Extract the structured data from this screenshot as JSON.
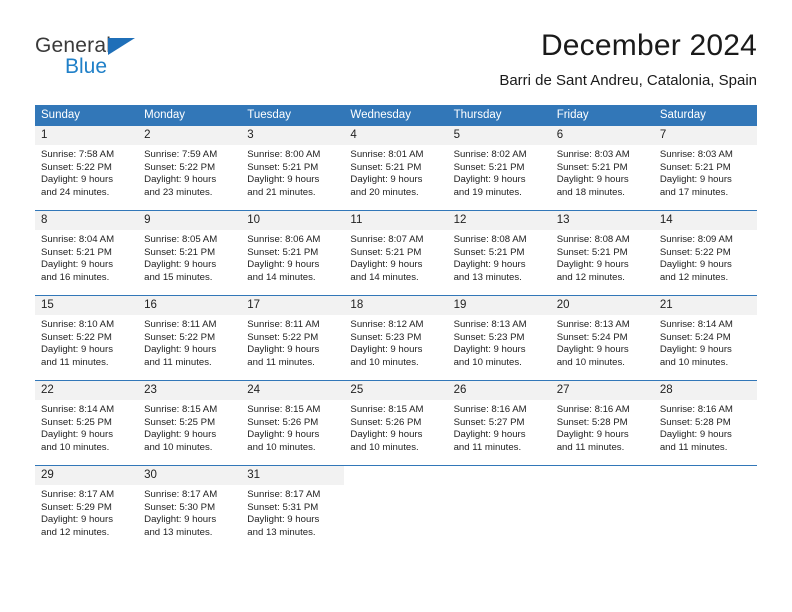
{
  "brand": {
    "name_part1": "General",
    "name_part2": "Blue",
    "accent_color": "#2080c8",
    "triangle_color": "#1f6fb8",
    "triangle_icon": "triangle-icon"
  },
  "header": {
    "title": "December 2024",
    "subtitle": "Barri de Sant Andreu, Catalonia, Spain"
  },
  "calendar": {
    "header_bg": "#3277b8",
    "header_text_color": "#ffffff",
    "daynum_bg": "#f2f2f2",
    "weekdays": [
      "Sunday",
      "Monday",
      "Tuesday",
      "Wednesday",
      "Thursday",
      "Friday",
      "Saturday"
    ],
    "weeks": [
      [
        {
          "day": "1",
          "sunrise": "Sunrise: 7:58 AM",
          "sunset": "Sunset: 5:22 PM",
          "daylight_line1": "Daylight: 9 hours",
          "daylight_line2": "and 24 minutes."
        },
        {
          "day": "2",
          "sunrise": "Sunrise: 7:59 AM",
          "sunset": "Sunset: 5:22 PM",
          "daylight_line1": "Daylight: 9 hours",
          "daylight_line2": "and 23 minutes."
        },
        {
          "day": "3",
          "sunrise": "Sunrise: 8:00 AM",
          "sunset": "Sunset: 5:21 PM",
          "daylight_line1": "Daylight: 9 hours",
          "daylight_line2": "and 21 minutes."
        },
        {
          "day": "4",
          "sunrise": "Sunrise: 8:01 AM",
          "sunset": "Sunset: 5:21 PM",
          "daylight_line1": "Daylight: 9 hours",
          "daylight_line2": "and 20 minutes."
        },
        {
          "day": "5",
          "sunrise": "Sunrise: 8:02 AM",
          "sunset": "Sunset: 5:21 PM",
          "daylight_line1": "Daylight: 9 hours",
          "daylight_line2": "and 19 minutes."
        },
        {
          "day": "6",
          "sunrise": "Sunrise: 8:03 AM",
          "sunset": "Sunset: 5:21 PM",
          "daylight_line1": "Daylight: 9 hours",
          "daylight_line2": "and 18 minutes."
        },
        {
          "day": "7",
          "sunrise": "Sunrise: 8:03 AM",
          "sunset": "Sunset: 5:21 PM",
          "daylight_line1": "Daylight: 9 hours",
          "daylight_line2": "and 17 minutes."
        }
      ],
      [
        {
          "day": "8",
          "sunrise": "Sunrise: 8:04 AM",
          "sunset": "Sunset: 5:21 PM",
          "daylight_line1": "Daylight: 9 hours",
          "daylight_line2": "and 16 minutes."
        },
        {
          "day": "9",
          "sunrise": "Sunrise: 8:05 AM",
          "sunset": "Sunset: 5:21 PM",
          "daylight_line1": "Daylight: 9 hours",
          "daylight_line2": "and 15 minutes."
        },
        {
          "day": "10",
          "sunrise": "Sunrise: 8:06 AM",
          "sunset": "Sunset: 5:21 PM",
          "daylight_line1": "Daylight: 9 hours",
          "daylight_line2": "and 14 minutes."
        },
        {
          "day": "11",
          "sunrise": "Sunrise: 8:07 AM",
          "sunset": "Sunset: 5:21 PM",
          "daylight_line1": "Daylight: 9 hours",
          "daylight_line2": "and 14 minutes."
        },
        {
          "day": "12",
          "sunrise": "Sunrise: 8:08 AM",
          "sunset": "Sunset: 5:21 PM",
          "daylight_line1": "Daylight: 9 hours",
          "daylight_line2": "and 13 minutes."
        },
        {
          "day": "13",
          "sunrise": "Sunrise: 8:08 AM",
          "sunset": "Sunset: 5:21 PM",
          "daylight_line1": "Daylight: 9 hours",
          "daylight_line2": "and 12 minutes."
        },
        {
          "day": "14",
          "sunrise": "Sunrise: 8:09 AM",
          "sunset": "Sunset: 5:22 PM",
          "daylight_line1": "Daylight: 9 hours",
          "daylight_line2": "and 12 minutes."
        }
      ],
      [
        {
          "day": "15",
          "sunrise": "Sunrise: 8:10 AM",
          "sunset": "Sunset: 5:22 PM",
          "daylight_line1": "Daylight: 9 hours",
          "daylight_line2": "and 11 minutes."
        },
        {
          "day": "16",
          "sunrise": "Sunrise: 8:11 AM",
          "sunset": "Sunset: 5:22 PM",
          "daylight_line1": "Daylight: 9 hours",
          "daylight_line2": "and 11 minutes."
        },
        {
          "day": "17",
          "sunrise": "Sunrise: 8:11 AM",
          "sunset": "Sunset: 5:22 PM",
          "daylight_line1": "Daylight: 9 hours",
          "daylight_line2": "and 11 minutes."
        },
        {
          "day": "18",
          "sunrise": "Sunrise: 8:12 AM",
          "sunset": "Sunset: 5:23 PM",
          "daylight_line1": "Daylight: 9 hours",
          "daylight_line2": "and 10 minutes."
        },
        {
          "day": "19",
          "sunrise": "Sunrise: 8:13 AM",
          "sunset": "Sunset: 5:23 PM",
          "daylight_line1": "Daylight: 9 hours",
          "daylight_line2": "and 10 minutes."
        },
        {
          "day": "20",
          "sunrise": "Sunrise: 8:13 AM",
          "sunset": "Sunset: 5:24 PM",
          "daylight_line1": "Daylight: 9 hours",
          "daylight_line2": "and 10 minutes."
        },
        {
          "day": "21",
          "sunrise": "Sunrise: 8:14 AM",
          "sunset": "Sunset: 5:24 PM",
          "daylight_line1": "Daylight: 9 hours",
          "daylight_line2": "and 10 minutes."
        }
      ],
      [
        {
          "day": "22",
          "sunrise": "Sunrise: 8:14 AM",
          "sunset": "Sunset: 5:25 PM",
          "daylight_line1": "Daylight: 9 hours",
          "daylight_line2": "and 10 minutes."
        },
        {
          "day": "23",
          "sunrise": "Sunrise: 8:15 AM",
          "sunset": "Sunset: 5:25 PM",
          "daylight_line1": "Daylight: 9 hours",
          "daylight_line2": "and 10 minutes."
        },
        {
          "day": "24",
          "sunrise": "Sunrise: 8:15 AM",
          "sunset": "Sunset: 5:26 PM",
          "daylight_line1": "Daylight: 9 hours",
          "daylight_line2": "and 10 minutes."
        },
        {
          "day": "25",
          "sunrise": "Sunrise: 8:15 AM",
          "sunset": "Sunset: 5:26 PM",
          "daylight_line1": "Daylight: 9 hours",
          "daylight_line2": "and 10 minutes."
        },
        {
          "day": "26",
          "sunrise": "Sunrise: 8:16 AM",
          "sunset": "Sunset: 5:27 PM",
          "daylight_line1": "Daylight: 9 hours",
          "daylight_line2": "and 11 minutes."
        },
        {
          "day": "27",
          "sunrise": "Sunrise: 8:16 AM",
          "sunset": "Sunset: 5:28 PM",
          "daylight_line1": "Daylight: 9 hours",
          "daylight_line2": "and 11 minutes."
        },
        {
          "day": "28",
          "sunrise": "Sunrise: 8:16 AM",
          "sunset": "Sunset: 5:28 PM",
          "daylight_line1": "Daylight: 9 hours",
          "daylight_line2": "and 11 minutes."
        }
      ],
      [
        {
          "day": "29",
          "sunrise": "Sunrise: 8:17 AM",
          "sunset": "Sunset: 5:29 PM",
          "daylight_line1": "Daylight: 9 hours",
          "daylight_line2": "and 12 minutes."
        },
        {
          "day": "30",
          "sunrise": "Sunrise: 8:17 AM",
          "sunset": "Sunset: 5:30 PM",
          "daylight_line1": "Daylight: 9 hours",
          "daylight_line2": "and 13 minutes."
        },
        {
          "day": "31",
          "sunrise": "Sunrise: 8:17 AM",
          "sunset": "Sunset: 5:31 PM",
          "daylight_line1": "Daylight: 9 hours",
          "daylight_line2": "and 13 minutes."
        },
        {
          "day": "",
          "sunrise": "",
          "sunset": "",
          "daylight_line1": "",
          "daylight_line2": ""
        },
        {
          "day": "",
          "sunrise": "",
          "sunset": "",
          "daylight_line1": "",
          "daylight_line2": ""
        },
        {
          "day": "",
          "sunrise": "",
          "sunset": "",
          "daylight_line1": "",
          "daylight_line2": ""
        },
        {
          "day": "",
          "sunrise": "",
          "sunset": "",
          "daylight_line1": "",
          "daylight_line2": ""
        }
      ]
    ]
  }
}
